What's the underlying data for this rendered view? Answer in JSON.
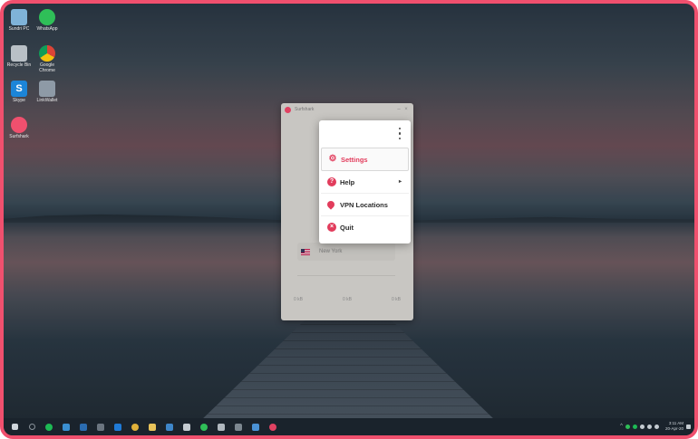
{
  "desktop": {
    "icons": [
      {
        "label": "Sundri PC",
        "icon": "computer-icon"
      },
      {
        "label": "WhatsApp",
        "icon": "whatsapp-icon"
      },
      {
        "label": "Recycle Bin",
        "icon": "recycle-bin-icon"
      },
      {
        "label": "Google Chrome",
        "icon": "chrome-icon"
      },
      {
        "label": "Skype",
        "icon": "skype-icon"
      },
      {
        "label": "LinkWallet",
        "icon": "app-icon"
      },
      {
        "label": "Surfshark",
        "icon": "vpn-icon"
      }
    ]
  },
  "vpn_window": {
    "title": "Surfshark",
    "location": "New York",
    "stats": [
      "0 kB",
      "0 kB",
      "0 kB"
    ]
  },
  "menu": {
    "items": [
      {
        "label": "Settings",
        "icon": "gear-icon"
      },
      {
        "label": "Help",
        "icon": "help-icon"
      },
      {
        "label": "VPN Locations",
        "icon": "location-pin-icon"
      },
      {
        "label": "Quit",
        "icon": "close-icon"
      }
    ]
  },
  "taskbar": {
    "time": "3:11 AM",
    "date": "20-Apr-20"
  },
  "colors": {
    "accent": "#e23c5c",
    "frame": "#f0506e",
    "taskbar": "#1a232c"
  }
}
